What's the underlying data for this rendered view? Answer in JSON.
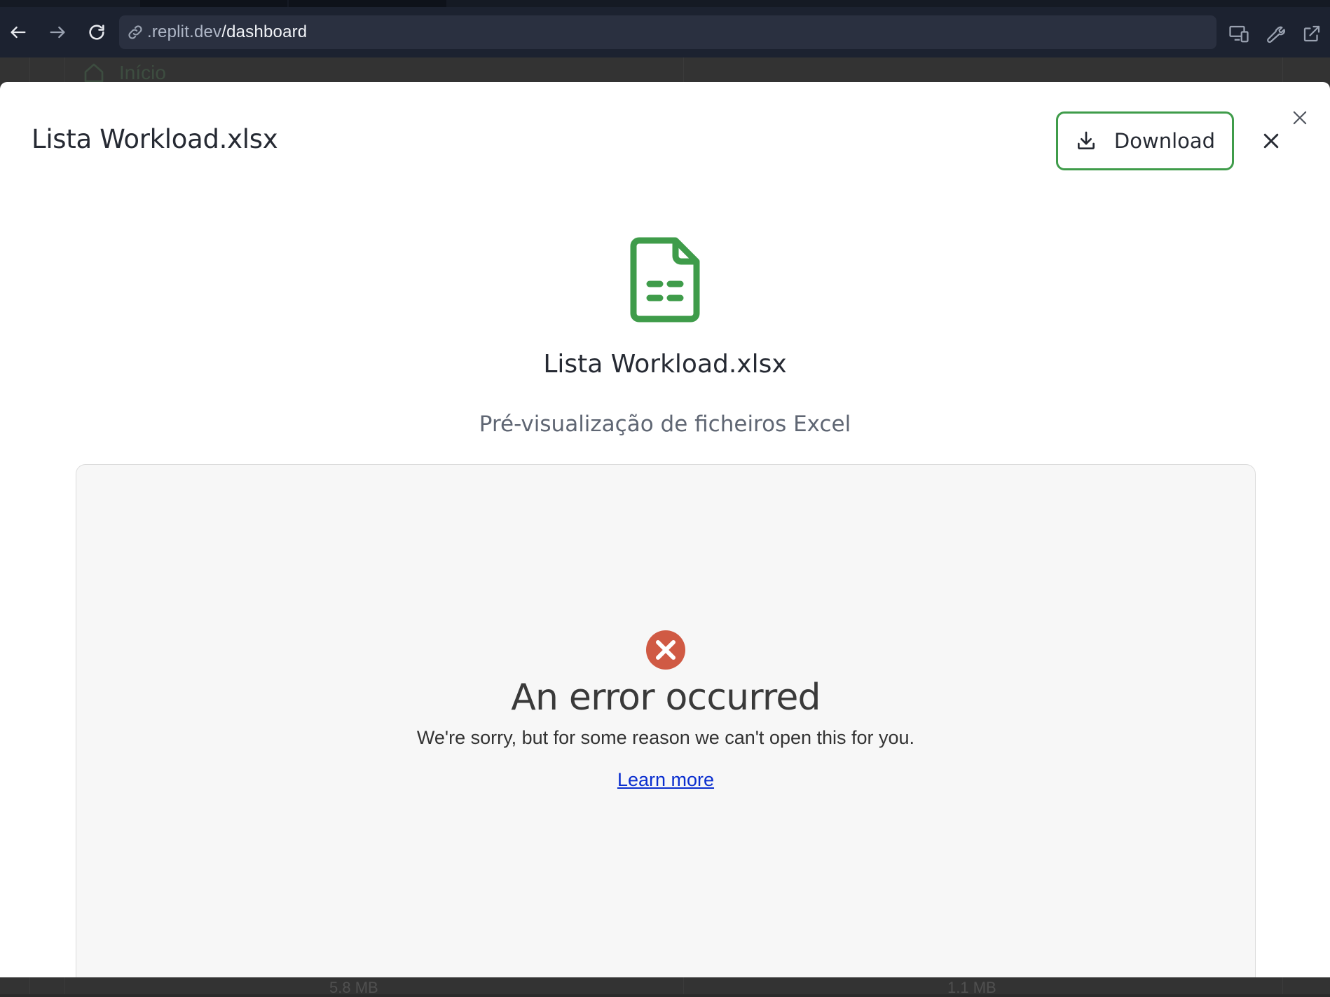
{
  "browser": {
    "url_host": ".replit.dev",
    "url_path": "/dashboard",
    "icons": [
      "back-arrow-icon",
      "forward-arrow-icon",
      "reload-icon",
      "link-icon",
      "devices-icon",
      "wrench-icon",
      "external-link-icon"
    ]
  },
  "background": {
    "nav_home_label": "Início",
    "sizes": [
      "5.8 MB",
      "1.1 MB"
    ]
  },
  "modal": {
    "title": "Lista Workload.xlsx",
    "download_label": "Download",
    "file_name": "Lista Workload.xlsx",
    "subtitle": "Pré-visualização de ficheiros Excel",
    "accent_color": "#3f9c4a"
  },
  "error": {
    "title": "An error occurred",
    "message": "We're sorry, but for some reason we can't open this for you.",
    "link_label": "Learn more",
    "icon_color": "#d05a44"
  }
}
